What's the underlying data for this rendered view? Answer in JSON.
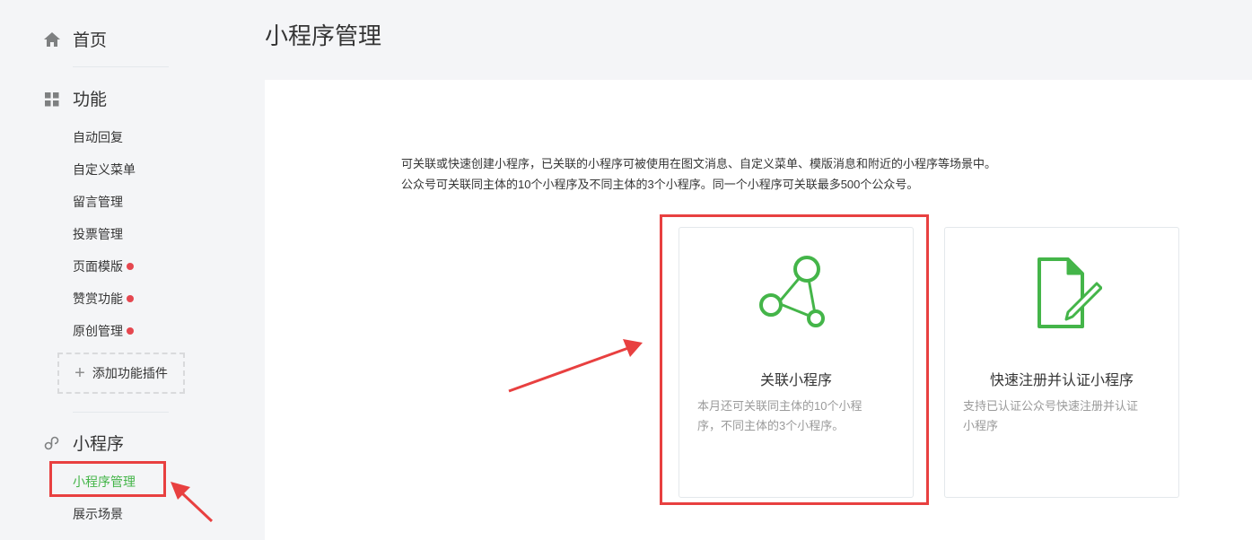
{
  "sidebar": {
    "home": {
      "label": "首页",
      "icon": "home-icon"
    },
    "features": {
      "label": "功能",
      "icon": "grid-icon",
      "items": [
        {
          "label": "自动回复",
          "dot": false
        },
        {
          "label": "自定义菜单",
          "dot": false
        },
        {
          "label": "留言管理",
          "dot": false
        },
        {
          "label": "投票管理",
          "dot": false
        },
        {
          "label": "页面模版",
          "dot": true
        },
        {
          "label": "赞赏功能",
          "dot": true
        },
        {
          "label": "原创管理",
          "dot": true
        }
      ],
      "add_plugin_label": "添加功能插件"
    },
    "miniprogram": {
      "label": "小程序",
      "icon": "link-icon",
      "items": [
        {
          "label": "小程序管理",
          "active": true
        },
        {
          "label": "展示场景",
          "active": false
        }
      ]
    }
  },
  "header": {
    "title": "小程序管理"
  },
  "main": {
    "description": [
      "可关联或快速创建小程序，已关联的小程序可被使用在图文消息、自定义菜单、模版消息和附近的小程序等场景中。",
      "公众号可关联同主体的10个小程序及不同主体的3个小程序。同一个小程序可关联最多500个公众号。"
    ],
    "cards": [
      {
        "title": "关联小程序",
        "icon": "connect-nodes-icon",
        "desc_lines": [
          "本月还可关联同主体的10个小程",
          "序，不同主体的3个小程序。"
        ]
      },
      {
        "title": "快速注册并认证小程序",
        "icon": "document-pen-icon",
        "desc_lines": [
          "支持已认证公众号快速注册并认证",
          "小程序"
        ]
      }
    ]
  },
  "colors": {
    "accent_green": "#44b549",
    "annotation_red": "#e84040",
    "badge_red": "#e5474f"
  }
}
